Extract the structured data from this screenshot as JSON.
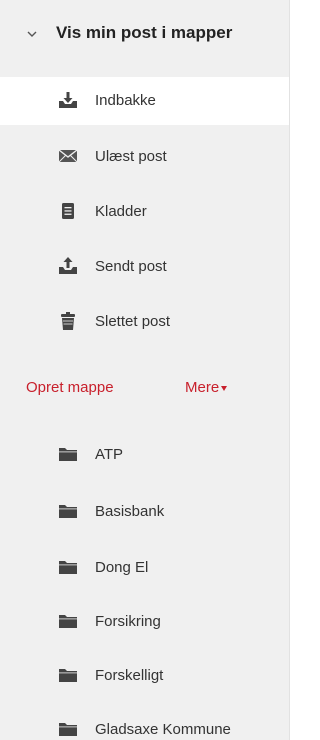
{
  "header": {
    "title": "Vis min post i mapper",
    "chevron_icon": "chevron-down-icon"
  },
  "system_folders": [
    {
      "label": "Indbakke",
      "icon": "inbox-download-icon",
      "selected": true
    },
    {
      "label": "Ulæst post",
      "icon": "envelope-icon",
      "selected": false
    },
    {
      "label": "Kladder",
      "icon": "document-lines-icon",
      "selected": false
    },
    {
      "label": "Sendt post",
      "icon": "outbox-upload-icon",
      "selected": false
    },
    {
      "label": "Slettet post",
      "icon": "trash-can-icon",
      "selected": false
    }
  ],
  "actions": {
    "create_folder": "Opret mappe",
    "more": "Mere"
  },
  "user_folders": [
    {
      "label": "ATP",
      "icon": "folder-icon"
    },
    {
      "label": "Basisbank",
      "icon": "folder-icon"
    },
    {
      "label": "Dong El",
      "icon": "folder-icon"
    },
    {
      "label": "Forsikring",
      "icon": "folder-icon"
    },
    {
      "label": "Forskelligt",
      "icon": "folder-icon"
    },
    {
      "label": "Gladsaxe Kommune",
      "icon": "folder-icon"
    }
  ],
  "colors": {
    "panel_background": "#f0f0f0",
    "selected_background": "#ffffff",
    "accent_red": "#c8202c",
    "icon_gray": "#444444",
    "text": "#333333"
  }
}
